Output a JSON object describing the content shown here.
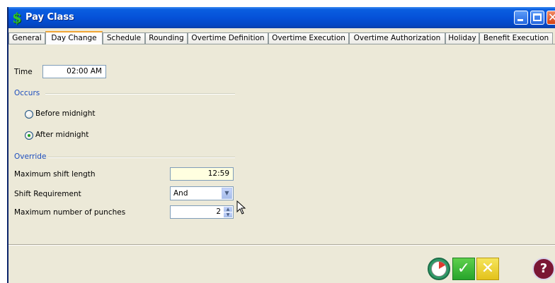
{
  "window": {
    "title": "Pay Class",
    "app_icon": "$",
    "close_glyph": "✕"
  },
  "tabs": [
    {
      "label": "General"
    },
    {
      "label": "Day Change"
    },
    {
      "label": "Schedule"
    },
    {
      "label": "Rounding"
    },
    {
      "label": "Overtime Definition"
    },
    {
      "label": "Overtime Execution"
    },
    {
      "label": "Overtime Authorization"
    },
    {
      "label": "Holiday"
    },
    {
      "label": "Benefit Execution"
    }
  ],
  "active_tab": "Day Change",
  "time": {
    "label": "Time",
    "value": "02:00 AM"
  },
  "occurs": {
    "heading": "Occurs",
    "options": [
      {
        "label": "Before midnight",
        "selected": false
      },
      {
        "label": "After midnight",
        "selected": true
      }
    ]
  },
  "override": {
    "heading": "Override",
    "max_shift_length": {
      "label": "Maximum shift length",
      "value": "12:59"
    },
    "shift_requirement": {
      "label": "Shift Requirement",
      "value": "And",
      "arrow": "▼"
    },
    "max_punches": {
      "label": "Maximum number of punches",
      "value": "2",
      "up": "▲",
      "down": "▼"
    }
  },
  "footer": {
    "ok_glyph": "✓",
    "cancel_glyph": "✕",
    "help_glyph": "?"
  },
  "colors": {
    "titlebar": "#0551d8",
    "section_heading": "#1e4ebe",
    "ok": "#27a42b",
    "cancel": "#e3c21b",
    "help": "#7a1634"
  }
}
